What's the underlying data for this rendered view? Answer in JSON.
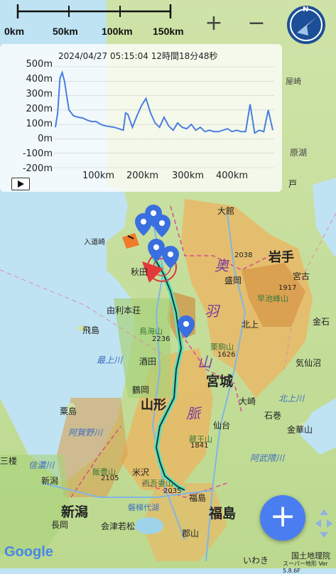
{
  "scale": {
    "labels": [
      "0km",
      "50km",
      "100km",
      "150km"
    ]
  },
  "zoom": {
    "in": "+",
    "out": "−"
  },
  "compass": {
    "letter": "N"
  },
  "elevation": {
    "timestamp": "2024/04/27 05:15:04 12時間18分48秒",
    "y_ticks": [
      "500m",
      "400m",
      "300m",
      "200m",
      "100m",
      "0m",
      "-100m",
      "-200m"
    ],
    "x_ticks": [
      "100km",
      "200km",
      "300km",
      "400km"
    ],
    "line_color": "#4a7de0",
    "chart_data": {
      "type": "line",
      "x": [
        0,
        5,
        10,
        15,
        20,
        25,
        30,
        40,
        50,
        60,
        70,
        80,
        90,
        100,
        110,
        120,
        130,
        140,
        150,
        155,
        160,
        170,
        180,
        190,
        200,
        210,
        220,
        230,
        240,
        250,
        260,
        270,
        280,
        290,
        300,
        310,
        320,
        330,
        340,
        350,
        360,
        370,
        380,
        390,
        400,
        410,
        420,
        430,
        440,
        450,
        460,
        470,
        480
      ],
      "y": [
        80,
        180,
        420,
        460,
        400,
        300,
        200,
        160,
        150,
        145,
        130,
        120,
        120,
        100,
        90,
        85,
        80,
        70,
        60,
        180,
        170,
        80,
        160,
        230,
        280,
        180,
        110,
        80,
        150,
        90,
        60,
        110,
        80,
        70,
        100,
        60,
        80,
        50,
        60,
        50,
        50,
        60,
        70,
        50,
        60,
        50,
        50,
        240,
        40,
        60,
        50,
        200,
        60
      ],
      "xlabel": "",
      "ylabel": "",
      "ylim": [
        -200,
        500
      ],
      "xlim": [
        0,
        480
      ]
    }
  },
  "regions": [
    "岩手",
    "新潟",
    "福島",
    "山形",
    "宮城"
  ],
  "cities": [
    "大館",
    "盛岡",
    "秋田",
    "由利本荘",
    "北上",
    "金石",
    "宮古",
    "酒田",
    "気仙沼",
    "鶴岡",
    "大崎",
    "仙台",
    "石巻",
    "米沢",
    "福島",
    "長岡",
    "会津若松",
    "郡山",
    "金華山",
    "新潟",
    "飛島",
    "粟島",
    "入道崎",
    "いわき",
    "三楼"
  ],
  "mountains": [
    "奥",
    "羽",
    "山",
    "脈",
    "最上川",
    "阿賀野川",
    "北上川",
    "阿武隈川",
    "信濃川",
    "早池峰山",
    "鳥海山",
    "栗駒山",
    "蔵王山",
    "飯豊山",
    "西吾妻山",
    "磐梯代湖"
  ],
  "elevations": [
    "2038",
    "1917",
    "2236",
    "1626",
    "1841",
    "2105",
    "2035"
  ],
  "map_texts_faded": [
    "屋崎",
    "原湖",
    "戸"
  ],
  "controls": {
    "add": "+"
  },
  "attribution": {
    "google": "Google",
    "gsi": "国土地理院",
    "version": "スーパー地形 Ver 5.8.6F"
  }
}
